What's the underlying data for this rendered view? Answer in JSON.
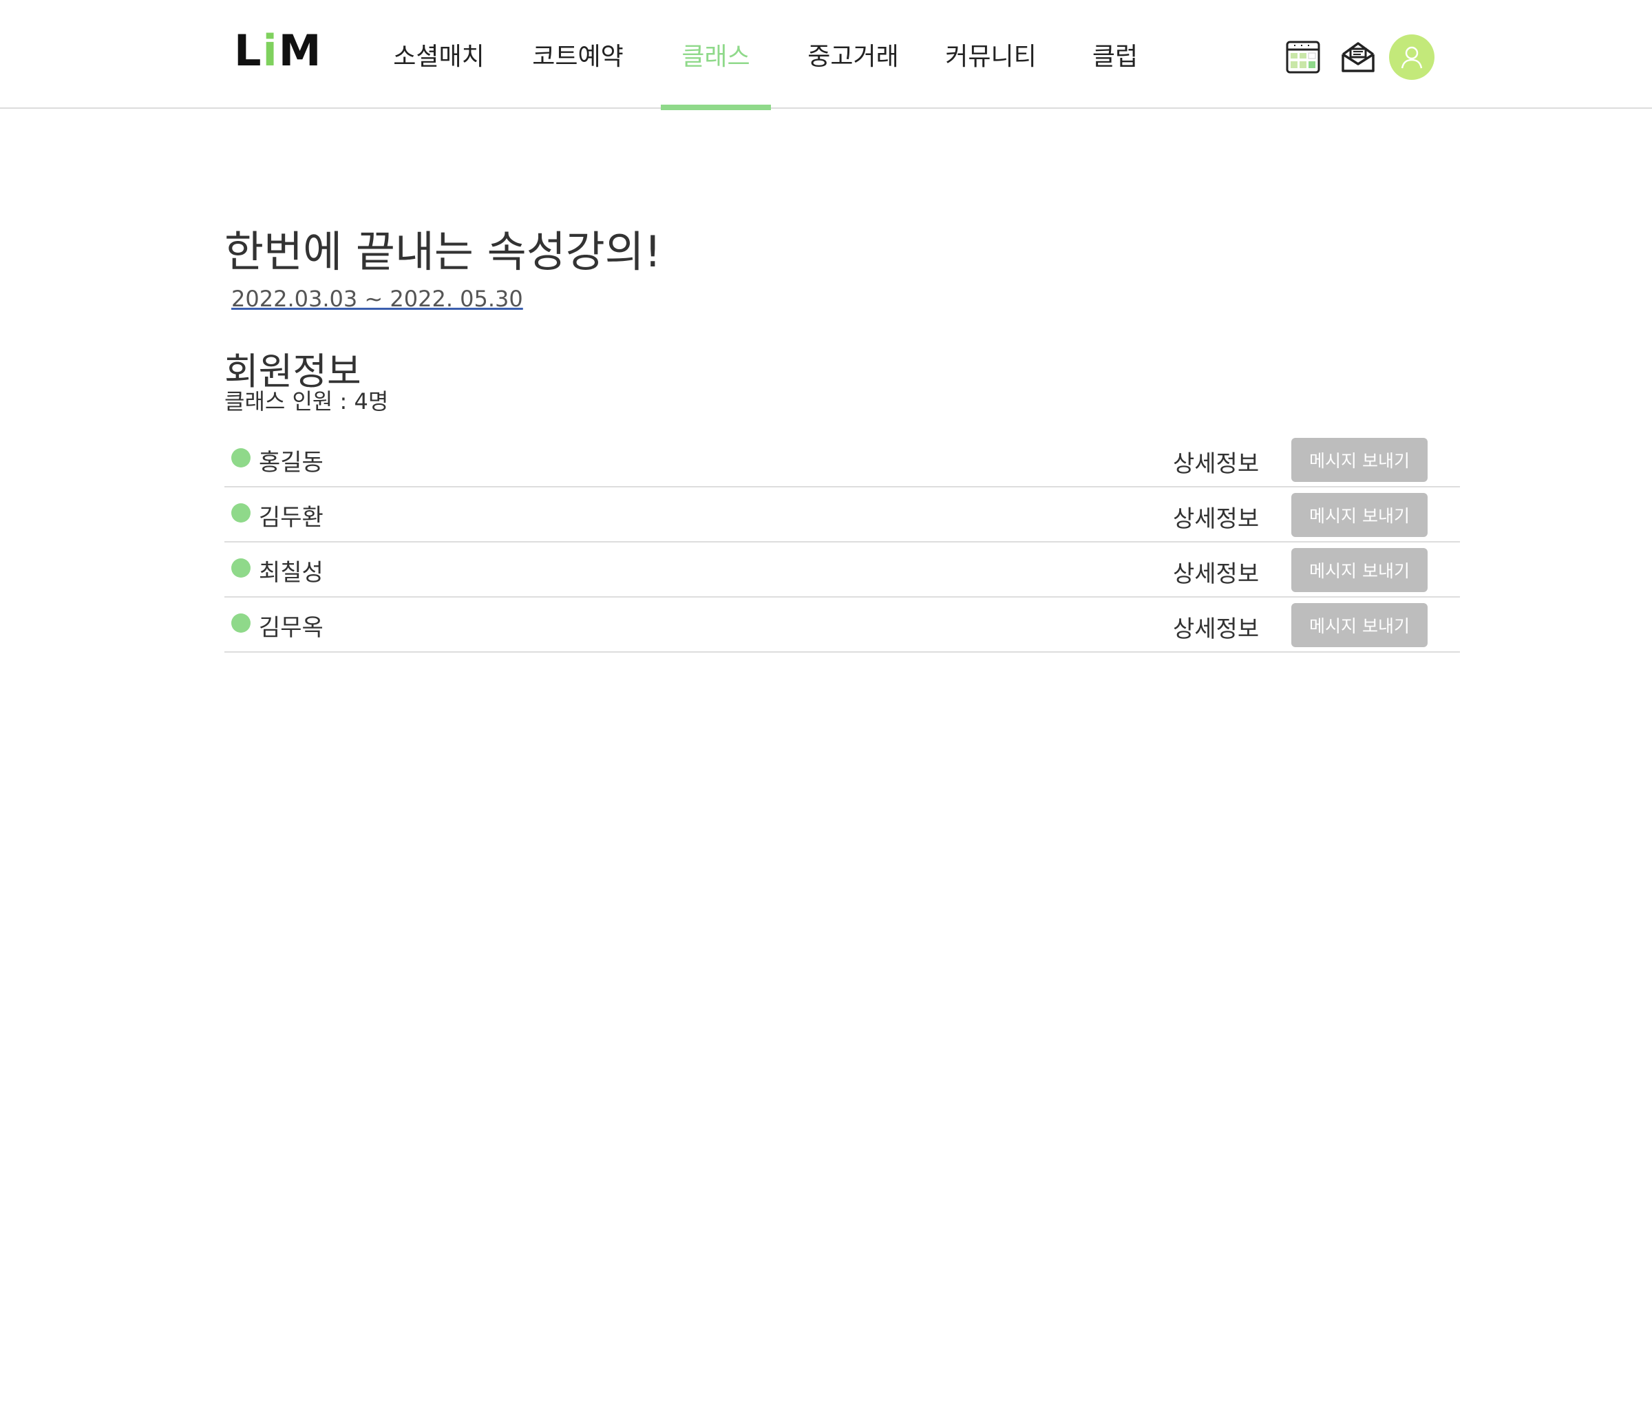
{
  "header": {
    "logo": {
      "left": "L",
      "accent": "i",
      "right": "M"
    },
    "nav": [
      {
        "label": "소셜매치",
        "active": false
      },
      {
        "label": "코트예약",
        "active": false
      },
      {
        "label": "클래스",
        "active": true
      },
      {
        "label": "중고거래",
        "active": false
      },
      {
        "label": "커뮤니티",
        "active": false
      },
      {
        "label": "클럽",
        "active": false
      }
    ],
    "icons": [
      "calendar-icon",
      "mail-icon",
      "user-avatar-icon"
    ]
  },
  "main": {
    "title": "한번에 끝내는 속성강의!",
    "period": "2022.03.03 ~ 2022. 05.30",
    "section_title": "회원정보",
    "member_count": "클래스 인원 : 4명",
    "members": [
      {
        "name": "홍길동",
        "detail_label": "상세정보",
        "message_label": "메시지 보내기"
      },
      {
        "name": "김두환",
        "detail_label": "상세정보",
        "message_label": "메시지 보내기"
      },
      {
        "name": "최칠성",
        "detail_label": "상세정보",
        "message_label": "메시지 보내기"
      },
      {
        "name": "김무옥",
        "detail_label": "상세정보",
        "message_label": "메시지 보내기"
      }
    ]
  },
  "colors": {
    "accent": "#8fd98a",
    "avatar_bg": "#c3e97a",
    "button_bg": "#bdbdbd",
    "status_dot": "#8fd98a"
  }
}
